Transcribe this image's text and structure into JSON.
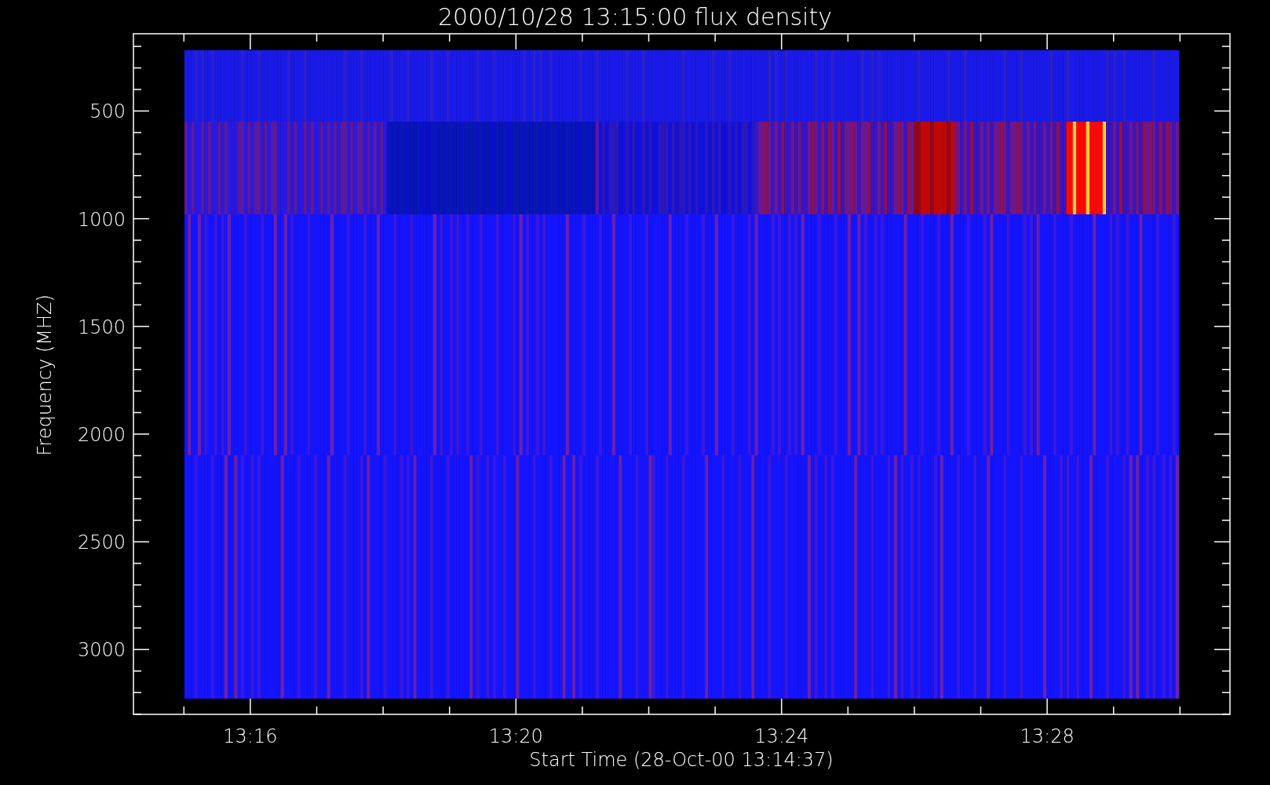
{
  "title": "2000/10/28 13:15:00 flux density",
  "x_axis": {
    "label": "Start Time (28-Oct-00 13:14:37)",
    "ticks": [
      "13:16",
      "13:20",
      "13:24",
      "13:28"
    ]
  },
  "y_axis": {
    "label": "Frequency (MHZ)",
    "ticks": [
      "500",
      "1000",
      "1500",
      "2000",
      "2500",
      "3000"
    ]
  }
}
